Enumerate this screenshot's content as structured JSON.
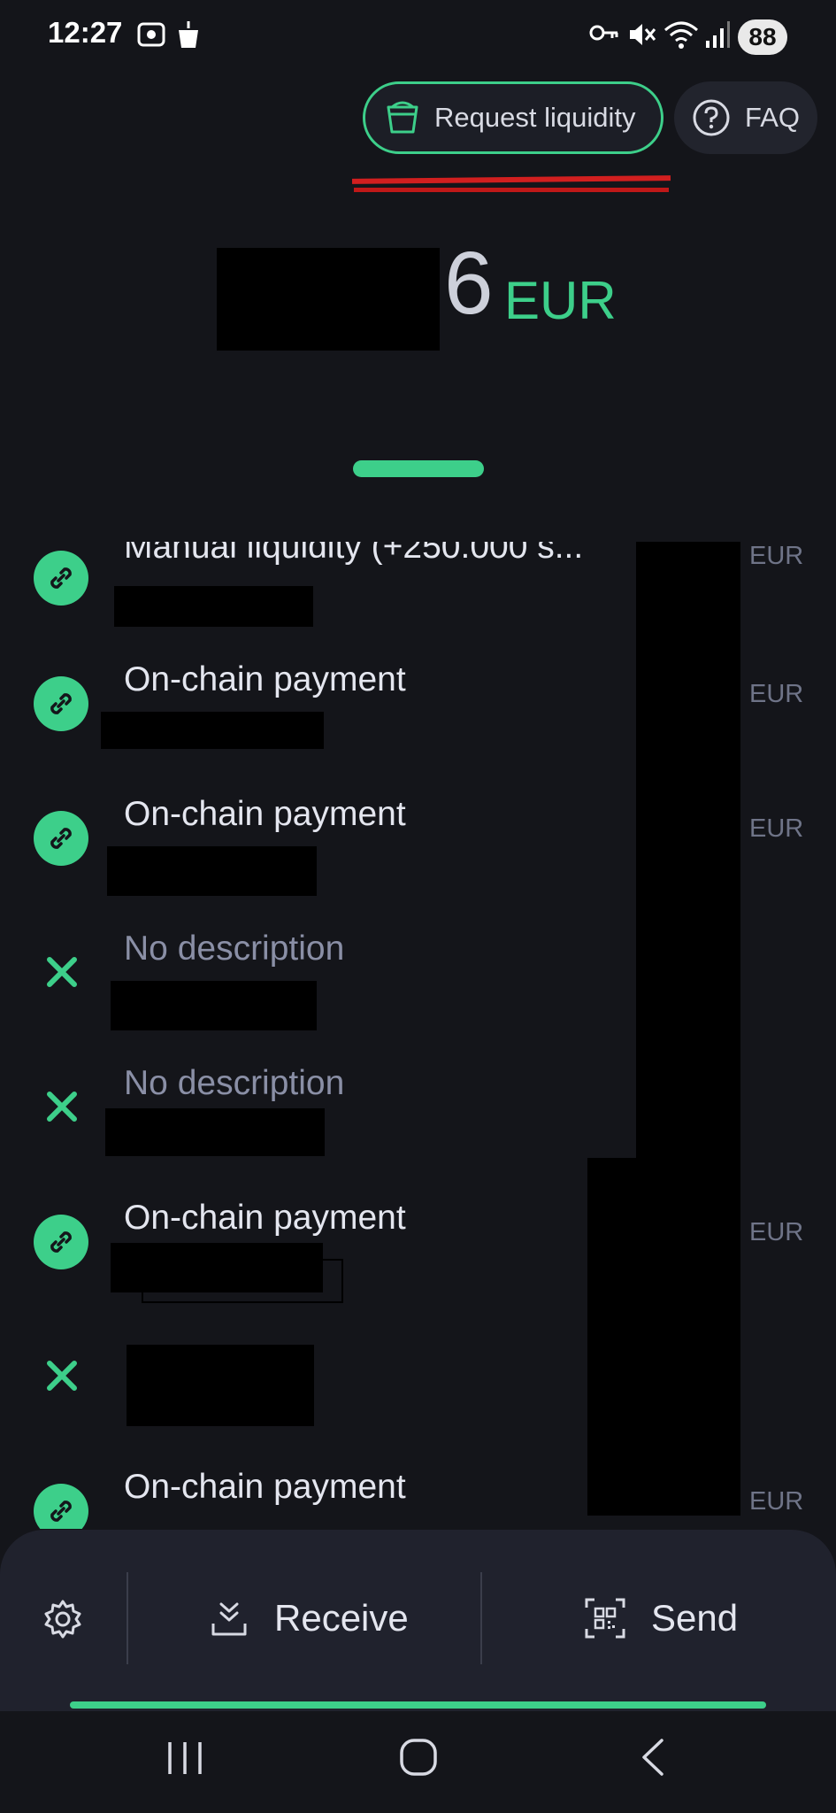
{
  "status_bar": {
    "time": "12:27",
    "battery": "88"
  },
  "header": {
    "request_liquidity_label": "Request liquidity",
    "faq_label": "FAQ"
  },
  "balance": {
    "visible_digit": "6",
    "currency": "EUR"
  },
  "transactions": [
    {
      "icon": "chain-link-icon",
      "title": "Manual liquidity (+250.000 s...",
      "currency": "EUR"
    },
    {
      "icon": "chain-link-icon",
      "title": "On-chain payment",
      "currency": "EUR"
    },
    {
      "icon": "chain-link-icon",
      "title": "On-chain payment",
      "currency": "EUR"
    },
    {
      "icon": "cross-icon",
      "title": "No description",
      "currency": ""
    },
    {
      "icon": "cross-icon",
      "title": "No description",
      "currency": ""
    },
    {
      "icon": "chain-link-icon",
      "title": "On-chain payment",
      "currency": "EUR"
    },
    {
      "icon": "cross-icon",
      "title": "",
      "currency": ""
    },
    {
      "icon": "chain-link-icon",
      "title": "On-chain payment",
      "currency": "EUR"
    }
  ],
  "bottom_bar": {
    "receive_label": "Receive",
    "send_label": "Send"
  },
  "colors": {
    "accent": "#3dcf8a",
    "background": "#14151a",
    "panel": "#20222d"
  }
}
